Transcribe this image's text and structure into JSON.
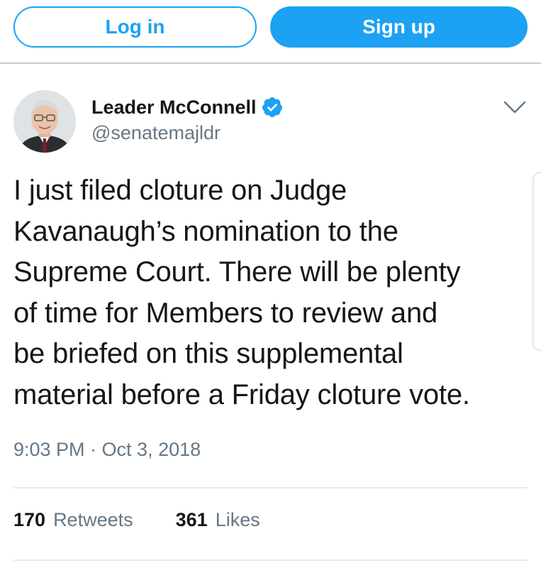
{
  "auth_bar": {
    "login_label": "Log in",
    "signup_label": "Sign up"
  },
  "tweet": {
    "author": {
      "display_name": "Leader McConnell",
      "handle": "@senatemajldr",
      "verified": true,
      "avatar_icon": "avatar-photo",
      "verified_icon": "verified-badge-icon"
    },
    "menu_icon": "chevron-down-icon",
    "text_lines": [
      "I just filed cloture on Judge",
      "Kavanaugh’s nomination to the",
      "Supreme Court. There will be plenty",
      "of time for Members to review and",
      "be briefed on this supplemental",
      "material before a Friday cloture vote."
    ],
    "timestamp": "9:03 PM · Oct 3, 2018",
    "stats": {
      "retweets_count": "170",
      "retweets_label": "Retweets",
      "likes_count": "361",
      "likes_label": "Likes"
    }
  },
  "colors": {
    "brand_blue": "#1da1f2",
    "text_primary": "#14171a",
    "text_secondary": "#657786",
    "divider": "#e6ecf0"
  }
}
